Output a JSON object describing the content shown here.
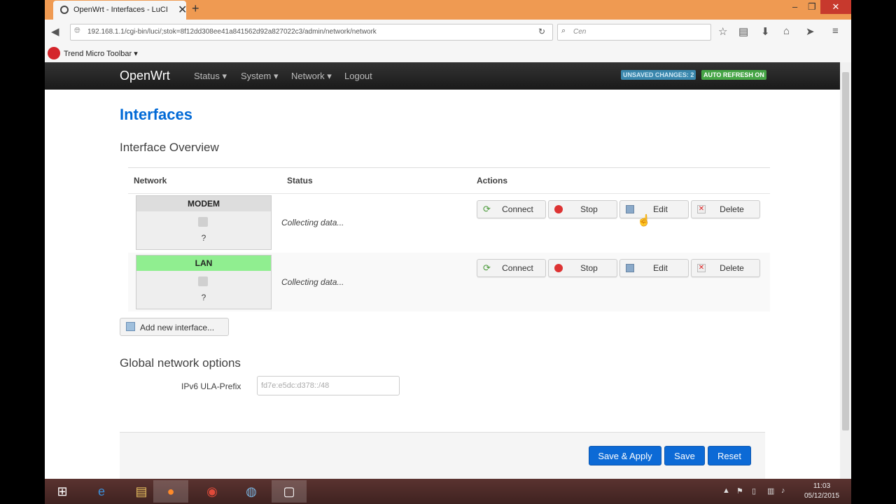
{
  "browser": {
    "tab_title": "OpenWrt - Interfaces - LuCI",
    "tab_close": "✕",
    "new_tab": "+",
    "url": "192.168.1.1/cgi-bin/luci/;stok=8f12dd308ee41a841562d92a827022c3/admin/network/network",
    "search_placeholder": "Cen",
    "window_controls": {
      "minimize": "–",
      "restore": "❐",
      "close": "✕"
    },
    "toolbar_label": "Trend Micro Toolbar ▾"
  },
  "header": {
    "brand": "OpenWrt",
    "menu": [
      "Status ▾",
      "System ▾",
      "Network ▾",
      "Logout"
    ],
    "badges": {
      "unsaved": "UNSAVED CHANGES: 2",
      "autorefresh": "AUTO REFRESH ON"
    }
  },
  "page": {
    "title": "Interfaces",
    "subtitle": "Interface Overview",
    "columns": {
      "network": "Network",
      "status": "Status",
      "actions": "Actions"
    },
    "interfaces": [
      {
        "name": "MODEM",
        "status": "Collecting data...",
        "device": "?",
        "header_color": "#dddddd"
      },
      {
        "name": "LAN",
        "status": "Collecting data...",
        "device": "?",
        "header_color": "#90ee90"
      }
    ],
    "actions": {
      "connect": "Connect",
      "stop": "Stop",
      "edit": "Edit",
      "delete": "Delete"
    },
    "add_interface": "Add new interface...",
    "global_title": "Global network options",
    "ula_label": "IPv6 ULA-Prefix",
    "ula_value": "fd7e:e5dc:d378::/48",
    "buttons": {
      "save_apply": "Save & Apply",
      "save": "Save",
      "reset": "Reset"
    }
  },
  "taskbar": {
    "time": "11:03",
    "date": "05/12/2015"
  },
  "colors": {
    "accent": "#0069d6",
    "unsaved_badge": "#3a87ad",
    "autorefresh_badge": "#46a546",
    "titlebar": "#ef9a52"
  }
}
